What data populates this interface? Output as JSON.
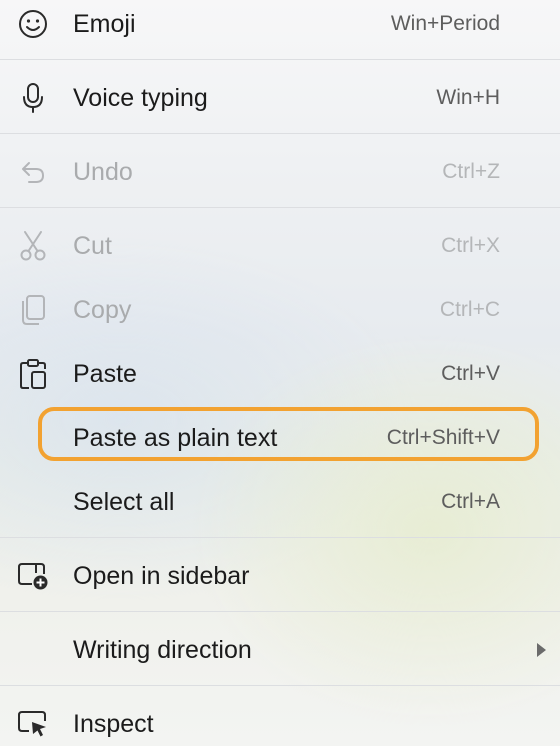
{
  "menu": {
    "items": [
      {
        "label": "Emoji",
        "shortcut": "Win+Period",
        "icon": "emoji-icon",
        "disabled": false
      },
      {
        "label": "Voice typing",
        "shortcut": "Win+H",
        "icon": "microphone-icon",
        "disabled": false
      },
      {
        "label": "Undo",
        "shortcut": "Ctrl+Z",
        "icon": "undo-icon",
        "disabled": true
      },
      {
        "label": "Cut",
        "shortcut": "Ctrl+X",
        "icon": "scissors-icon",
        "disabled": true
      },
      {
        "label": "Copy",
        "shortcut": "Ctrl+C",
        "icon": "copy-icon",
        "disabled": true
      },
      {
        "label": "Paste",
        "shortcut": "Ctrl+V",
        "icon": "clipboard-icon",
        "disabled": false
      },
      {
        "label": "Paste as plain text",
        "shortcut": "Ctrl+Shift+V",
        "icon": "",
        "disabled": false,
        "highlighted": true
      },
      {
        "label": "Select all",
        "shortcut": "Ctrl+A",
        "icon": "",
        "disabled": false
      },
      {
        "label": "Open in sidebar",
        "shortcut": "",
        "icon": "sidebar-add-icon",
        "disabled": false
      },
      {
        "label": "Writing direction",
        "shortcut": "",
        "icon": "",
        "disabled": false,
        "submenu": true,
        "submenu_icon": "chevron-right-icon"
      },
      {
        "label": "Inspect",
        "shortcut": "",
        "icon": "inspect-icon",
        "disabled": false
      }
    ]
  },
  "colors": {
    "highlight_border": "#f2a231",
    "text": "#1b1b1b",
    "disabled_text": "#a9abad",
    "shortcut_text": "#5d5d5d"
  }
}
